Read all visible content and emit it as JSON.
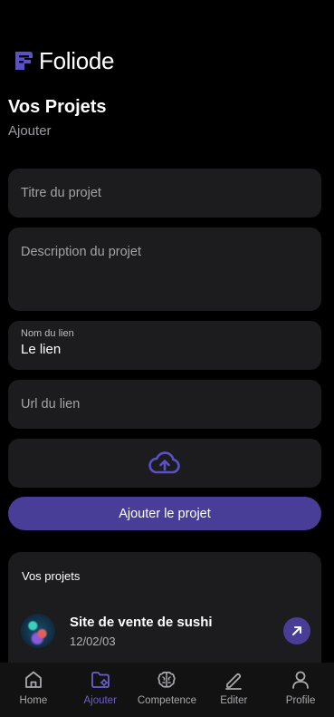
{
  "app": {
    "name": "Foliode"
  },
  "page": {
    "title": "Vos Projets",
    "subtitle": "Ajouter"
  },
  "form": {
    "title_placeholder": "Titre du projet",
    "description_placeholder": "Description du projet",
    "link_name_label": "Nom du lien",
    "link_name_value": "Le lien",
    "url_placeholder": "Url du lien",
    "upload_icon": "cloud-upload-icon",
    "submit_label": "Ajouter le projet"
  },
  "projects": {
    "title": "Vos projets",
    "items": [
      {
        "name": "Site de vente de sushi",
        "date": "12/02/03",
        "icon": "arrow-up-right-icon"
      }
    ]
  },
  "nav": {
    "items": [
      {
        "label": "Home",
        "icon": "home-icon"
      },
      {
        "label": "Ajouter",
        "icon": "folder-settings-icon",
        "active": true
      },
      {
        "label": "Competence",
        "icon": "brain-icon"
      },
      {
        "label": "Editer",
        "icon": "pen-icon"
      },
      {
        "label": "Profile",
        "icon": "user-icon"
      }
    ]
  },
  "colors": {
    "background": "#000000",
    "surface": "#1c1c1e",
    "accent": "#483e98",
    "accent_light": "#6a5fd0",
    "nav_background": "#121212"
  }
}
